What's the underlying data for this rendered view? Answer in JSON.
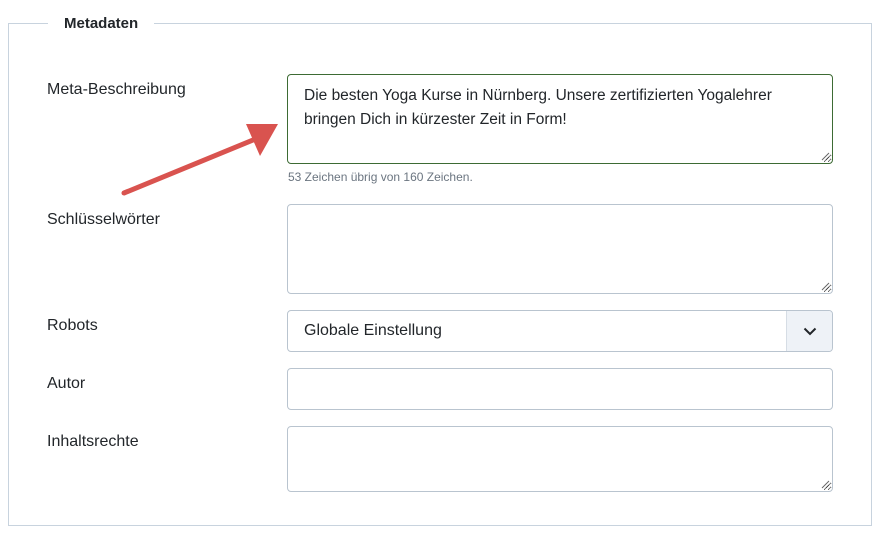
{
  "fieldset": {
    "legend": "Metadaten"
  },
  "meta_description": {
    "label": "Meta-Beschreibung",
    "value": "Die besten Yoga Kurse in Nürnberg. Unsere zertifizierten Yogalehrer bringen Dich in kürzester Zeit in Form!",
    "char_hint": "53 Zeichen übrig von 160 Zeichen."
  },
  "keywords": {
    "label": "Schlüsselwörter",
    "value": ""
  },
  "robots": {
    "label": "Robots",
    "selected": "Globale Einstellung",
    "dropdown_icon": "chevron-down-icon"
  },
  "author": {
    "label": "Autor",
    "value": ""
  },
  "rights": {
    "label": "Inhaltsrechte",
    "value": ""
  },
  "annotation": {
    "arrow_color": "#d9534f"
  },
  "colors": {
    "active_border": "#3d6b34",
    "border": "#b9c4cf",
    "select_button_bg": "#eef2f7"
  }
}
